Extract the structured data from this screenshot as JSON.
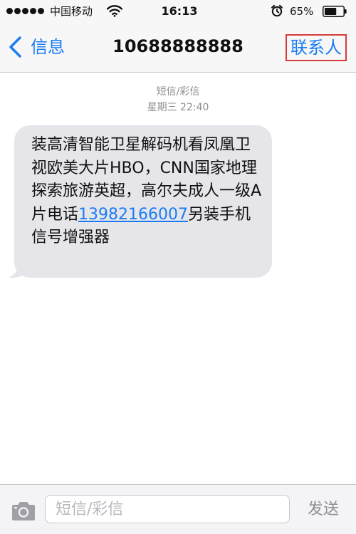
{
  "status_bar": {
    "carrier": "中国移动",
    "time": "16:13",
    "battery_percent": "65%",
    "battery_level": 0.65,
    "signal_icon": "signal-dots-icon",
    "wifi_icon": "wifi-icon",
    "alarm_icon": "alarm-clock-icon",
    "battery_icon": "battery-icon"
  },
  "nav": {
    "back_label": "信息",
    "back_icon": "chevron-left-icon",
    "title": "10688888888",
    "contact_label": "联系人"
  },
  "conversation": {
    "message_type": "短信/彩信",
    "timestamp": "星期三 22:40",
    "message": {
      "text_before_link": "装高清智能卫星解码机看凤凰卫视欧美大片HBO，CNN国家地理探索旅游英超，高尔夫成人一级A片电话",
      "link_text": "13982166007",
      "text_after_link": "另装手机信号增强器"
    }
  },
  "input_bar": {
    "camera_icon": "camera-icon",
    "placeholder": "短信/彩信",
    "send_label": "发送"
  },
  "colors": {
    "accent": "#1a7cf4",
    "bubble": "#e5e5ea",
    "highlight_border": "#d63a3a",
    "secondary_text": "#8e8e93"
  }
}
